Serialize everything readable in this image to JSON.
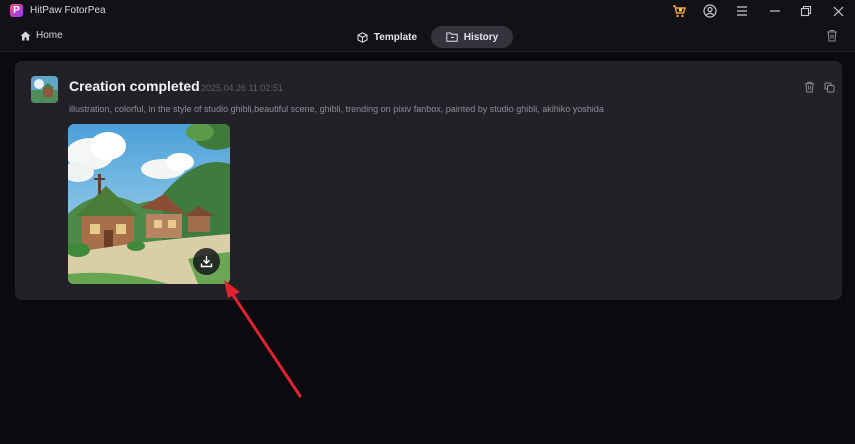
{
  "app": {
    "title": "HitPaw FotorPea",
    "logo_letter": "P"
  },
  "titlebar": {
    "icons": [
      "cart-icon",
      "account-icon",
      "menu-icon",
      "minimize-icon",
      "restore-icon",
      "close-icon"
    ]
  },
  "nav": {
    "home_label": "Home",
    "tabs": [
      {
        "label": "Template",
        "icon": "cube-icon",
        "active": false
      },
      {
        "label": "History",
        "icon": "folder-icon",
        "active": true
      }
    ]
  },
  "creation": {
    "title": "Creation completed",
    "timestamp": "2025.04.26 11:02:51",
    "prompt": "illustration, colorful, in the style of studio ghibli,beautiful scene, ghibli, trending on pixiv fanbox, painted by studio ghibli, akihiko yoshida"
  },
  "colors": {
    "background": "#0b0b0f",
    "card": "#212127",
    "active_tab": "#34343c",
    "arrow": "#e0212f"
  }
}
